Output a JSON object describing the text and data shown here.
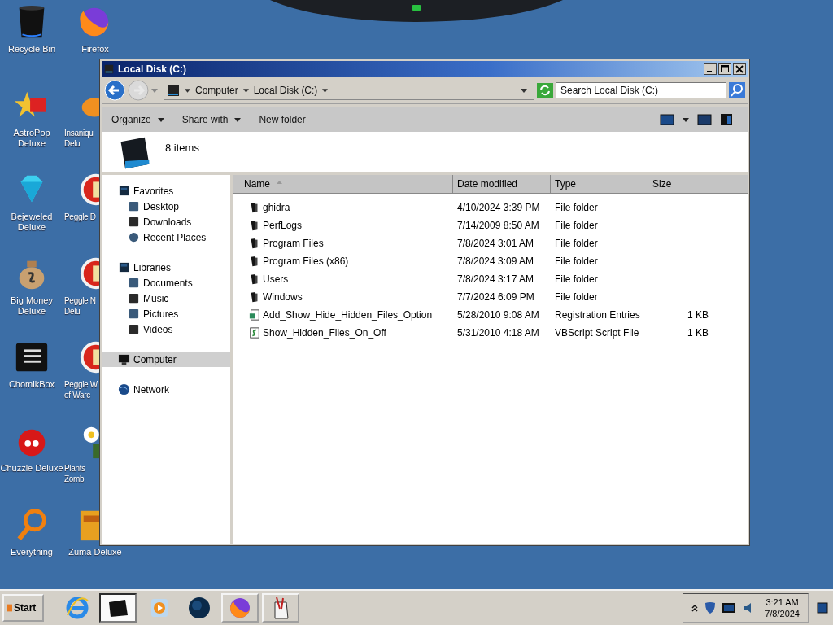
{
  "desktop_icons": [
    {
      "lines": [
        "Recycle Bin"
      ],
      "clipped": false
    },
    {
      "lines": [
        "AstroPop",
        "Deluxe"
      ],
      "clipped": false
    },
    {
      "lines": [
        "Bejeweled",
        "Deluxe"
      ],
      "clipped": false
    },
    {
      "lines": [
        "Big Money",
        "Deluxe"
      ],
      "clipped": false
    },
    {
      "lines": [
        "ChomikBox"
      ],
      "clipped": false
    },
    {
      "lines": [
        "Chuzzle Deluxe"
      ],
      "clipped": false
    },
    {
      "lines": [
        "Everything"
      ],
      "clipped": false
    },
    {
      "lines": [
        "Firefox"
      ],
      "clipped": false
    },
    {
      "lines": [
        "Insaniqu",
        "Delu"
      ],
      "clipped": true
    },
    {
      "lines": [
        "Peggle D"
      ],
      "clipped": true
    },
    {
      "lines": [
        "Peggle N",
        "Delu"
      ],
      "clipped": true
    },
    {
      "lines": [
        "Peggle W",
        "of Warc"
      ],
      "clipped": true
    },
    {
      "lines": [
        "Plants",
        "Zomb"
      ],
      "clipped": true
    },
    {
      "lines": [
        "Zuma Deluxe"
      ],
      "clipped": false
    }
  ],
  "window": {
    "title": "Local Disk (C:)",
    "address": {
      "back_enabled": true,
      "forward_enabled": false,
      "breadcrumbs": [
        "Computer",
        "Local Disk (C:)"
      ]
    },
    "search": {
      "placeholder": "Search Local Disk (C:)"
    },
    "toolbar": [
      {
        "label": "Organize",
        "dropdown": true
      },
      {
        "label": "Share with",
        "dropdown": true
      },
      {
        "label": "New folder",
        "dropdown": false
      }
    ],
    "details": {
      "count": "8 items"
    },
    "navigation": [
      {
        "label": "Favorites",
        "selected": false,
        "children": [
          {
            "label": "Desktop",
            "selected": false
          },
          {
            "label": "Downloads",
            "selected": false
          },
          {
            "label": "Recent Places",
            "selected": false
          }
        ]
      },
      {
        "label": "Libraries",
        "selected": false,
        "children": [
          {
            "label": "Documents",
            "selected": false
          },
          {
            "label": "Music",
            "selected": false
          },
          {
            "label": "Pictures",
            "selected": false
          },
          {
            "label": "Videos",
            "selected": false
          }
        ]
      },
      {
        "label": "Computer",
        "selected": true
      },
      {
        "label": "Network",
        "selected": false
      }
    ],
    "table": {
      "columns": [
        {
          "label": "Name",
          "sorted": true
        },
        {
          "label": "Date modified",
          "sorted": false
        },
        {
          "label": "Type",
          "sorted": false
        },
        {
          "label": "Size",
          "sorted": false
        }
      ],
      "rows": [
        {
          "kind": "folder",
          "name": "ghidra",
          "date": "4/10/2024 3:39 PM",
          "type": "File folder"
        },
        {
          "kind": "folder",
          "name": "PerfLogs",
          "date": "7/14/2009 8:50 AM",
          "type": "File folder"
        },
        {
          "kind": "folder",
          "name": "Program Files",
          "date": "7/8/2024 3:01 AM",
          "type": "File folder"
        },
        {
          "kind": "folder",
          "name": "Program Files (x86)",
          "date": "7/8/2024 3:09 AM",
          "type": "File folder"
        },
        {
          "kind": "folder",
          "name": "Users",
          "date": "7/8/2024 3:17 AM",
          "type": "File folder"
        },
        {
          "kind": "folder",
          "name": "Windows",
          "date": "7/7/2024 6:09 PM",
          "type": "File folder"
        },
        {
          "kind": "registry",
          "name": "Add_Show_Hide_Hidden_Files_Option",
          "date": "5/28/2010 9:08 AM",
          "type": "Registration Entries",
          "size": "1 KB"
        },
        {
          "kind": "script",
          "name": "Show_Hidden_Files_On_Off",
          "date": "5/31/2010 4:18 AM",
          "type": "VBScript Script File",
          "size": "1 KB"
        }
      ]
    }
  },
  "taskbar": {
    "start": "Start",
    "apps": [
      {
        "open": false,
        "active": false
      },
      {
        "open": true,
        "active": true
      },
      {
        "open": false,
        "active": false
      },
      {
        "open": false,
        "active": false
      },
      {
        "open": true,
        "active": false
      },
      {
        "open": true,
        "active": false
      }
    ],
    "time": "3:21 AM",
    "date": "7/8/2024"
  }
}
